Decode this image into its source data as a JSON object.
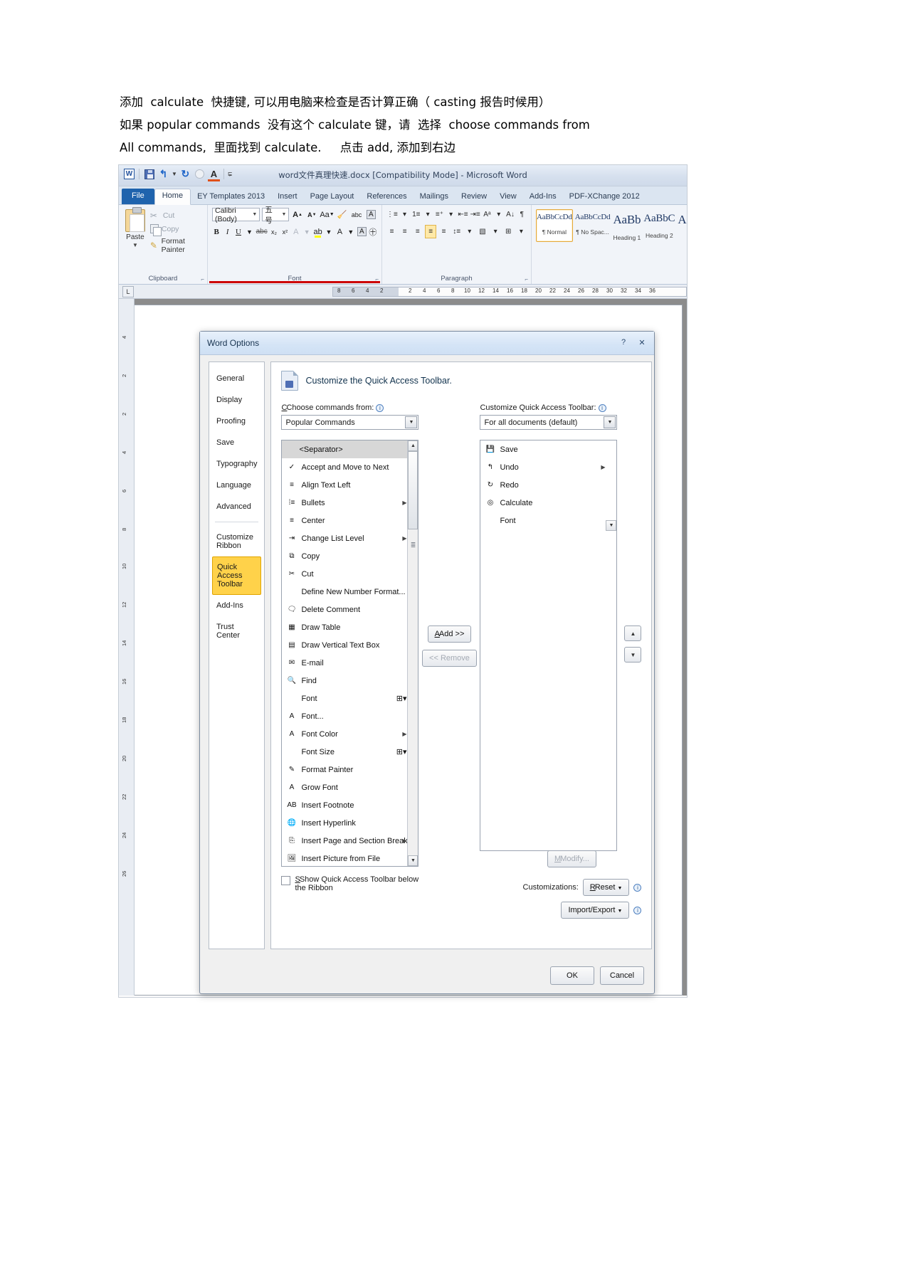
{
  "notes": [
    "添加  calculate  快捷键, 可以用电脑来检查是否计算正确（ casting 报告时候用）",
    "如果 popular commands  没有这个 calculate 键，请  选择  choose commands from",
    "All commands,  里面找到 calculate.     点击 add, 添加到右边"
  ],
  "word": {
    "title": "word文件真理快速.docx [Compatibility Mode] - Microsoft Word",
    "qat": [
      "word-icon",
      "save-icon",
      "undo-icon",
      "redo-icon",
      "circle-icon",
      "font-color-icon",
      "customize-icon"
    ],
    "tabs": [
      {
        "label": "File",
        "type": "file"
      },
      {
        "label": "Home",
        "type": "active"
      },
      {
        "label": "EY Templates 2013",
        "type": "normal"
      },
      {
        "label": "Insert",
        "type": "normal"
      },
      {
        "label": "Page Layout",
        "type": "normal"
      },
      {
        "label": "References",
        "type": "normal"
      },
      {
        "label": "Mailings",
        "type": "normal"
      },
      {
        "label": "Review",
        "type": "normal"
      },
      {
        "label": "View",
        "type": "normal"
      },
      {
        "label": "Add-Ins",
        "type": "normal"
      },
      {
        "label": "PDF-XChange 2012",
        "type": "normal"
      }
    ],
    "clipboard": {
      "group_label": "Clipboard",
      "paste": "Paste",
      "cut": "Cut",
      "copy": "Copy",
      "format_painter": "Format Painter"
    },
    "font": {
      "group_label": "Font",
      "font_name": "Calibri (Body)",
      "font_size": "五号",
      "bold": "B",
      "italic": "I",
      "underline": "U",
      "strike": "abc",
      "subscript": "x₂",
      "superscript": "x²",
      "grow": "A",
      "shrink": "A",
      "change_case": "Aa",
      "clear_formatting": "clear-formatting-icon",
      "phonetic": "abc",
      "char_border": "A"
    },
    "paragraph": {
      "group_label": "Paragraph"
    },
    "styles": [
      {
        "sample": "AaBbCcDd",
        "name": "¶ Normal",
        "selected": true
      },
      {
        "sample": "AaBbCcDd",
        "name": "¶ No Spac...",
        "selected": false
      },
      {
        "sample": "AaBb",
        "name": "Heading 1",
        "selected": false,
        "big": true
      },
      {
        "sample": "AaBbC",
        "name": "Heading 2",
        "selected": false
      },
      {
        "sample": "A",
        "name": "",
        "selected": false
      }
    ],
    "ruler": {
      "left_numbers": [
        "8",
        "6",
        "4",
        "2"
      ],
      "right_numbers": [
        "2",
        "4",
        "6",
        "8",
        "10",
        "12",
        "14",
        "16",
        "18",
        "20",
        "22",
        "24",
        "26",
        "28",
        "30",
        "32",
        "34",
        "36"
      ],
      "vertical_numbers": [
        "4",
        "2",
        "2",
        "4",
        "6",
        "8",
        "10",
        "12",
        "14",
        "16",
        "18",
        "20",
        "22",
        "24",
        "26"
      ],
      "tab_selector": "L"
    }
  },
  "dialog": {
    "title": "Word Options",
    "help_icon": "?",
    "close_icon": "✕",
    "nav": [
      {
        "label": "General",
        "selected": false
      },
      {
        "label": "Display",
        "selected": false
      },
      {
        "label": "Proofing",
        "selected": false
      },
      {
        "label": "Save",
        "selected": false
      },
      {
        "label": "Typography",
        "selected": false
      },
      {
        "label": "Language",
        "selected": false
      },
      {
        "label": "Advanced",
        "selected": false
      },
      {
        "label": "Customize Ribbon",
        "selected": false
      },
      {
        "label": "Quick Access Toolbar",
        "selected": true
      },
      {
        "label": "Add-Ins",
        "selected": false
      },
      {
        "label": "Trust Center",
        "selected": false
      }
    ],
    "pane_heading": "Customize the Quick Access Toolbar.",
    "left": {
      "label": "Choose commands from:",
      "label_underline": "C",
      "value": "Popular Commands",
      "items": [
        {
          "label": "<Separator>",
          "icon": "",
          "separator": true,
          "submenu": false
        },
        {
          "label": "Accept and Move to Next",
          "icon": "accept-change-icon",
          "submenu": false
        },
        {
          "label": "Align Text Left",
          "icon": "align-left-icon",
          "submenu": false
        },
        {
          "label": "Bullets",
          "icon": "bullets-icon",
          "submenu": true
        },
        {
          "label": "Center",
          "icon": "align-center-icon",
          "submenu": false
        },
        {
          "label": "Change List Level",
          "icon": "change-list-level-icon",
          "submenu": true
        },
        {
          "label": "Copy",
          "icon": "copy-icon",
          "submenu": false
        },
        {
          "label": "Cut",
          "icon": "cut-icon",
          "submenu": false
        },
        {
          "label": "Define New Number Format...",
          "icon": "",
          "submenu": false
        },
        {
          "label": "Delete Comment",
          "icon": "delete-comment-icon",
          "submenu": false
        },
        {
          "label": "Draw Table",
          "icon": "draw-table-icon",
          "submenu": false
        },
        {
          "label": "Draw Vertical Text Box",
          "icon": "text-box-icon",
          "submenu": false
        },
        {
          "label": "E-mail",
          "icon": "email-icon",
          "submenu": false
        },
        {
          "label": "Find",
          "icon": "find-icon",
          "submenu": false
        },
        {
          "label": "Font",
          "icon": "",
          "submenu": false,
          "gallery": true
        },
        {
          "label": "Font...",
          "icon": "font-dialog-icon",
          "submenu": false
        },
        {
          "label": "Font Color",
          "icon": "font-color-icon",
          "submenu": true
        },
        {
          "label": "Font Size",
          "icon": "",
          "submenu": false,
          "gallery": true
        },
        {
          "label": "Format Painter",
          "icon": "format-painter-icon",
          "submenu": false
        },
        {
          "label": "Grow Font",
          "icon": "grow-font-icon",
          "submenu": false
        },
        {
          "label": "Insert Footnote",
          "icon": "insert-footnote-icon",
          "submenu": false
        },
        {
          "label": "Insert Hyperlink",
          "icon": "hyperlink-icon",
          "submenu": false
        },
        {
          "label": "Insert Page and Section Breaks",
          "icon": "page-break-icon",
          "submenu": true
        },
        {
          "label": "Insert Picture from File",
          "icon": "insert-picture-icon",
          "submenu": false
        }
      ]
    },
    "right": {
      "label": "Customize Quick Access Toolbar:",
      "label_underline": "Q",
      "value": "For all documents (default)",
      "items": [
        {
          "label": "Save",
          "icon": "save-icon",
          "submenu": false
        },
        {
          "label": "Undo",
          "icon": "undo-icon",
          "submenu": true
        },
        {
          "label": "Redo",
          "icon": "redo-icon",
          "submenu": false
        },
        {
          "label": "Calculate",
          "icon": "calculate-icon",
          "submenu": false
        },
        {
          "label": "Font",
          "icon": "",
          "submenu": false
        }
      ]
    },
    "add_button": "Add >>",
    "add_underline": "A",
    "remove_button": "<< Remove",
    "remove_underline": "R",
    "move_up": "▲",
    "move_down": "▼",
    "show_below_checkbox": "Show Quick Access Toolbar below the Ribbon",
    "show_below_underline": "S",
    "modify_button": "Modify...",
    "modify_underline": "M",
    "customizations_label": "Customizations:",
    "reset_button": "Reset",
    "reset_underline": "R",
    "import_export_button": "Import/Export",
    "ok_button": "OK",
    "cancel_button": "Cancel",
    "accent_color": "#ffd24a"
  }
}
